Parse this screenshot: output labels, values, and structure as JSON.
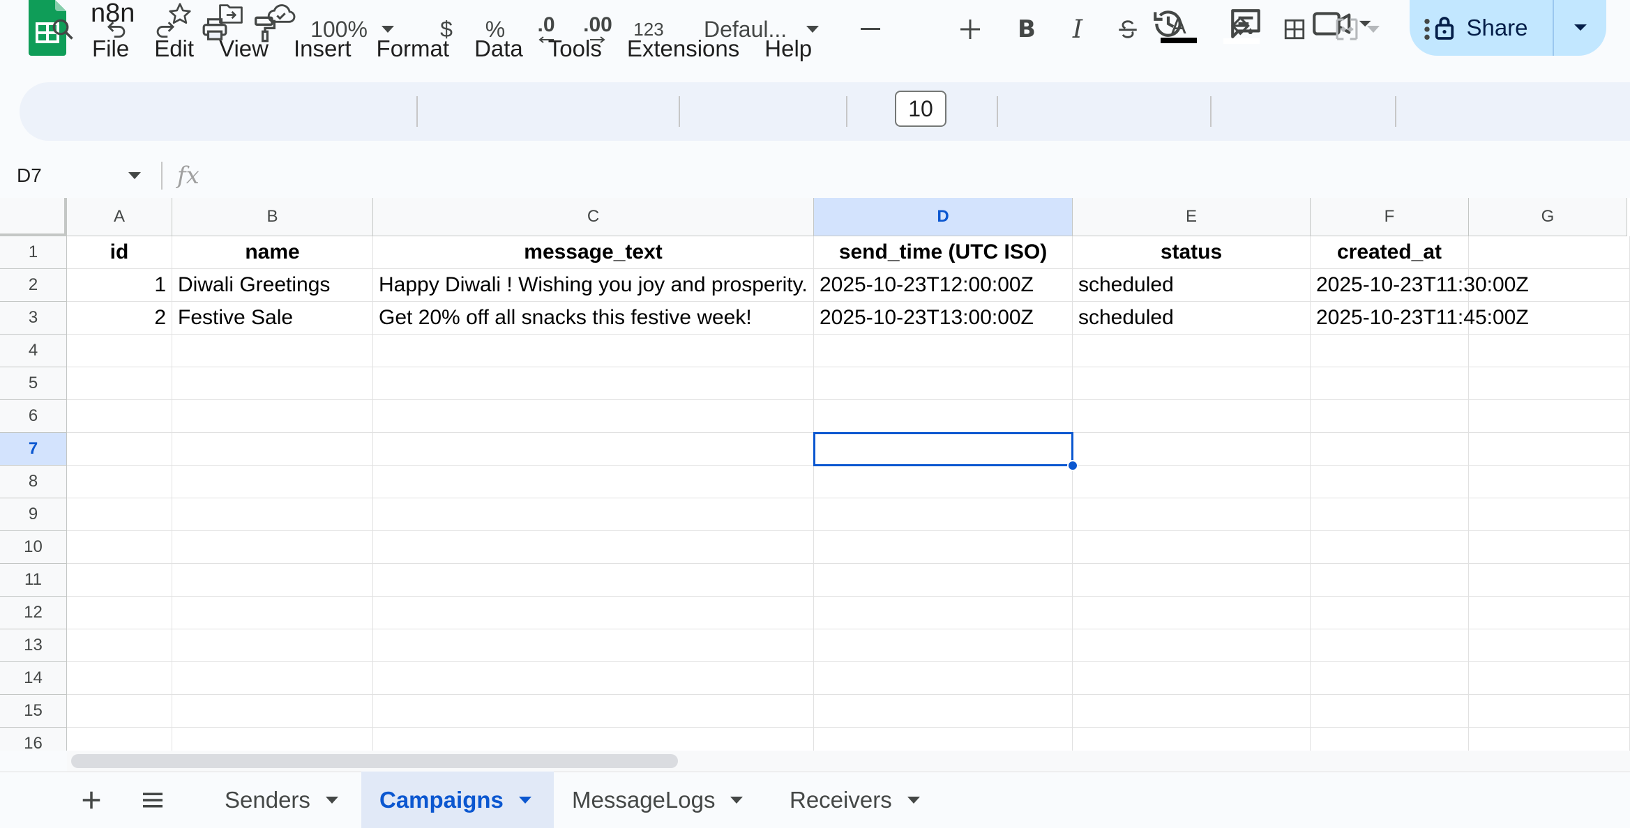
{
  "app": {
    "doc_title": "n8n",
    "menu": [
      "File",
      "Edit",
      "View",
      "Insert",
      "Format",
      "Data",
      "Tools",
      "Extensions",
      "Help"
    ],
    "share_label": "Share"
  },
  "toolbar": {
    "zoom": "100%",
    "currency": "$",
    "percent": "%",
    "decrease_decimal": ".0",
    "increase_decimal": ".00",
    "more_formats": "123",
    "font": "Defaul...",
    "font_size": "10"
  },
  "formula_bar": {
    "name_box": "D7",
    "fx": "fx",
    "value": ""
  },
  "grid": {
    "columns": [
      "A",
      "B",
      "C",
      "D",
      "E",
      "F",
      "G"
    ],
    "selected_column": "D",
    "rows": [
      "1",
      "2",
      "3",
      "4",
      "5",
      "6",
      "7",
      "8",
      "9",
      "10",
      "11",
      "12",
      "13",
      "14",
      "15",
      "16"
    ],
    "selected_row": "7",
    "header_row": [
      "id",
      "name",
      "message_text",
      "send_time (UTC ISO)",
      "status",
      "created_at"
    ],
    "data_rows": [
      [
        "1",
        "Diwali Greetings",
        "Happy Diwali ! Wishing you joy and prosperity.",
        "2025-10-23T12:00:00Z",
        "scheduled",
        "2025-10-23T11:30:00Z"
      ],
      [
        "2",
        "Festive Sale",
        "Get 20% off all snacks this festive week!",
        "2025-10-23T13:00:00Z",
        "scheduled",
        "2025-10-23T11:45:00Z"
      ]
    ]
  },
  "sheets": {
    "tabs": [
      "Senders",
      "Campaigns",
      "MessageLogs",
      "Receivers"
    ],
    "active": "Campaigns"
  },
  "colors": {
    "accent": "#0b57d0",
    "share_bg": "#c2e7ff",
    "logo_green": "#0f9d58"
  }
}
